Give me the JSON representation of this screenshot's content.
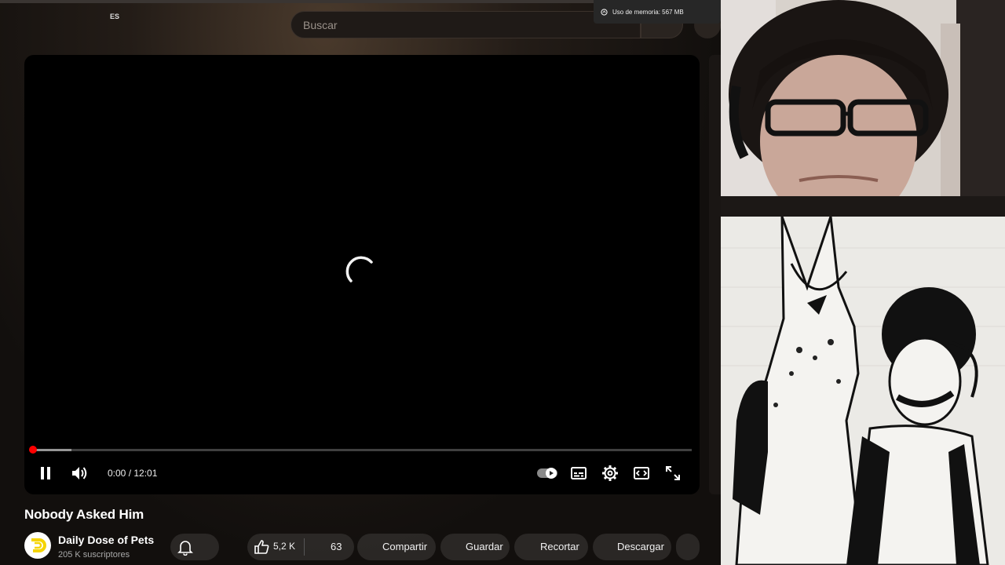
{
  "browser": {
    "lang_badge": "ES",
    "memory_tooltip": "Uso de memoria: 567 MB"
  },
  "search": {
    "placeholder": "Buscar"
  },
  "player": {
    "time": "0:00 / 12:01",
    "progress_fraction": 0.0,
    "buffer_fraction": 0.06,
    "state": "loading"
  },
  "video": {
    "title": "Nobody Asked Him",
    "channel_name": "Daily Dose of Pets",
    "subscribers": "205 K suscriptores",
    "likes": "5,2 K",
    "dislikes": "63",
    "share_label": "Compartir",
    "save_label": "Guardar",
    "clip_label": "Recortar",
    "download_label": "Descargar"
  },
  "colors": {
    "progress": "#ff0000",
    "avatar_accent": "#f5d400"
  },
  "icons": [
    "pause-icon",
    "volume-icon",
    "autoplay-icon",
    "subtitles-icon",
    "settings-icon",
    "theater-icon",
    "fullscreen-icon",
    "bell-icon",
    "like-icon",
    "memory-icon"
  ]
}
